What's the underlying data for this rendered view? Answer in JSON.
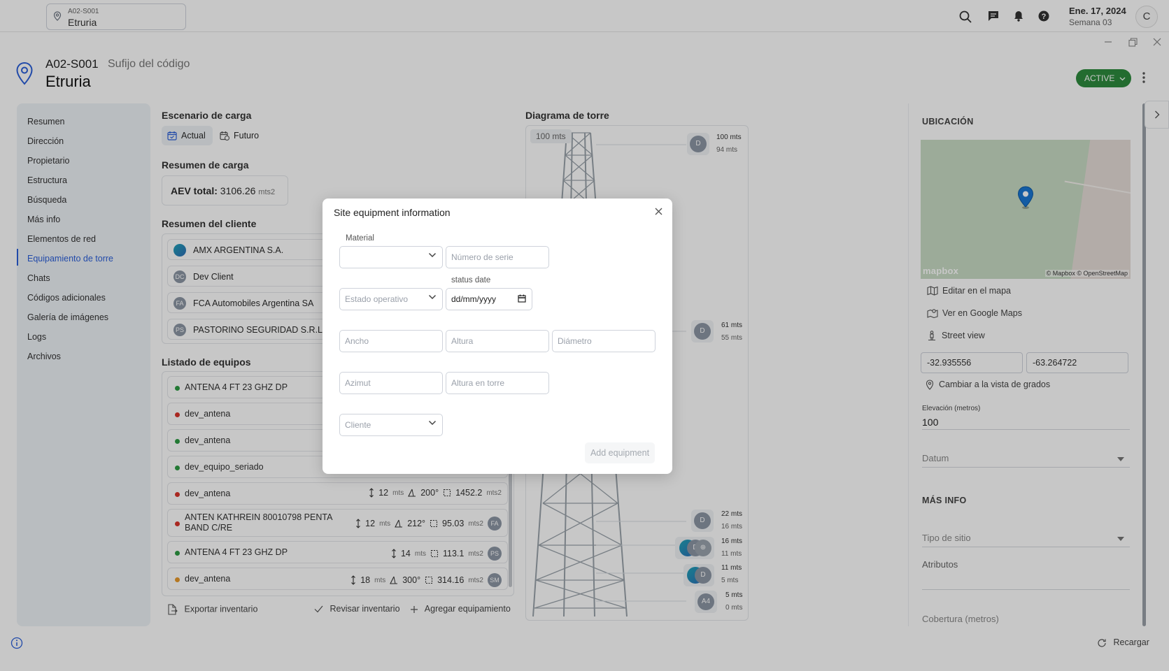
{
  "topbar": {
    "site_code": "A02-S001",
    "site_name": "Etruria",
    "date": "Ene. 17, 2024",
    "week": "Semana 03",
    "avatar_initial": "C"
  },
  "header": {
    "code": "A02-S001",
    "suffix": "Sufijo del código",
    "name": "Etruria",
    "status": "ACTIVE"
  },
  "sidebar": {
    "items": [
      {
        "label": "Resumen"
      },
      {
        "label": "Dirección"
      },
      {
        "label": "Propietario"
      },
      {
        "label": "Estructura"
      },
      {
        "label": "Búsqueda"
      },
      {
        "label": "Más info"
      },
      {
        "label": "Elementos de red"
      },
      {
        "label": "Equipamiento de torre"
      },
      {
        "label": "Chats"
      },
      {
        "label": "Códigos adicionales"
      },
      {
        "label": "Galería de imágenes"
      },
      {
        "label": "Logs"
      },
      {
        "label": "Archivos"
      }
    ],
    "active_index": 7
  },
  "load": {
    "scenario_title": "Escenario de carga",
    "actual_label": "Actual",
    "future_label": "Futuro",
    "summary_title": "Resumen de carga",
    "aev_label": "AEV total:",
    "aev_value": "3106.26",
    "aev_unit": "mts2"
  },
  "clients": {
    "title": "Resumen del cliente",
    "items": [
      {
        "initials": "",
        "name": "AMX ARGENTINA S.A."
      },
      {
        "initials": "DC",
        "name": "Dev Client"
      },
      {
        "initials": "FA",
        "name": "FCA Automobiles Argentina SA"
      },
      {
        "initials": "PS",
        "name": "PASTORINO SEGURIDAD S.R.L."
      }
    ]
  },
  "equipment": {
    "title": "Listado de equipos",
    "rows": [
      {
        "name": "ANTENA 4 FT 23 GHZ DP",
        "status_color": "#2e9b43"
      },
      {
        "name": "dev_antena",
        "status_color": "#d9342b"
      },
      {
        "name": "dev_antena",
        "status_color": "#2e9b43"
      },
      {
        "name": "dev_equipo_seriado",
        "status_color": "#2e9b43"
      },
      {
        "name": "dev_antena",
        "status_color": "#d9342b",
        "height": "12",
        "height_unit": "mts",
        "azimuth": "200°",
        "area": "1452.2",
        "area_unit": "mts2",
        "client": ""
      },
      {
        "name": "ANTEN KATHREIN 80010798 PENTA BAND C/RE",
        "status_color": "#d9342b",
        "height": "12",
        "height_unit": "mts",
        "azimuth": "212°",
        "area": "95.03",
        "area_unit": "mts2",
        "client": "FA"
      },
      {
        "name": "ANTENA 4 FT 23 GHZ DP",
        "status_color": "#2e9b43",
        "height": "14",
        "height_unit": "mts",
        "azimuth": "",
        "area": "113.1",
        "area_unit": "mts2",
        "client": "PS"
      },
      {
        "name": "dev_antena",
        "status_color": "#e89a2c",
        "height": "18",
        "height_unit": "mts",
        "azimuth": "300°",
        "area": "314.16",
        "area_unit": "mts2",
        "client": "SM"
      }
    ],
    "export_label": "Exportar inventario",
    "review_label": "Revisar inventario",
    "add_label": "Agregar equipamiento"
  },
  "tower": {
    "title": "Diagrama de torre",
    "height_label": "100 mts",
    "levels": [
      {
        "avatar": "D",
        "top": "100 mts",
        "bottom": "94 mts"
      },
      {
        "avatar": "D",
        "top": "61 mts",
        "bottom": "55 mts"
      },
      {
        "avatar": "D",
        "top": "22 mts",
        "bottom": "16 mts"
      },
      {
        "avatar": "D",
        "top": "16 mts",
        "bottom": "11 mts"
      },
      {
        "avatar": "D",
        "top": "11 mts",
        "bottom": "5 mts"
      },
      {
        "avatar": "A4",
        "top": "5 mts",
        "bottom": "0 mts"
      }
    ]
  },
  "location": {
    "title": "UBICACIÓN",
    "map_attribution": "© Mapbox © OpenStreetMap",
    "map_logo": "mapbox",
    "edit_map": "Editar en el mapa",
    "google_maps": "Ver en Google Maps",
    "street_view": "Street view",
    "lat": "-32.935556",
    "lng": "-63.264722",
    "change_degrees": "Cambiar a la vista de grados",
    "elevation_label": "Elevación (metros)",
    "elevation_value": "100",
    "datum_placeholder": "Datum"
  },
  "more_info": {
    "title": "MÁS INFO",
    "site_type_placeholder": "Tipo de sitio",
    "attributes_label": "Atributos",
    "coverage_label": "Cobertura (metros)"
  },
  "footer": {
    "reload_label": "Recargar"
  },
  "modal": {
    "title": "Site equipment information",
    "material_label": "Material",
    "serial_placeholder": "Número de serie",
    "op_state_placeholder": "Estado operativo",
    "status_date_label": "status date",
    "status_date_value": "dd/mm/yyyy",
    "width_placeholder": "Ancho",
    "height_placeholder": "Altura",
    "diameter_placeholder": "Diámetro",
    "azimuth_placeholder": "Azimut",
    "tower_height_placeholder": "Altura en torre",
    "client_placeholder": "Cliente",
    "add_button": "Add equipment"
  }
}
